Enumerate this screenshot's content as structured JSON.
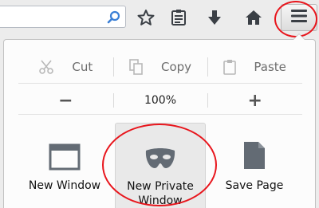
{
  "toolbar": {
    "search_icon": "magnifier-icon",
    "star_icon": "bookmark-star-icon",
    "list_icon": "reading-list-icon",
    "download_icon": "download-arrow-icon",
    "home_icon": "home-icon",
    "menu_icon": "hamburger-menu-icon"
  },
  "menu": {
    "edit": {
      "cut": "Cut",
      "copy": "Copy",
      "paste": "Paste"
    },
    "zoom": {
      "minus": "−",
      "level": "100%",
      "plus": "+"
    },
    "buttons": {
      "new_window": "New Window",
      "private_line1": "New Private",
      "private_line2": "Window",
      "save_page": "Save Page"
    }
  },
  "colors": {
    "annotation_red": "#e8151c",
    "icon_gray": "#636b74",
    "accent_blue": "#3a7fd6"
  }
}
